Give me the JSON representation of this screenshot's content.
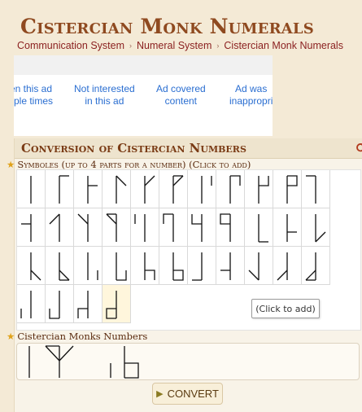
{
  "page": {
    "title": "Cistercian Monk Numerals",
    "breadcrumb": [
      "Communication System",
      "Numeral System",
      "Cistercian Monk Numerals"
    ]
  },
  "ad": {
    "options": [
      {
        "line1": "en this ad",
        "line2": "tiple times"
      },
      {
        "line1": "Not interested",
        "line2": "in this ad"
      },
      {
        "line1": "Ad covered",
        "line2": "content"
      },
      {
        "line1": "Ad was",
        "line2": "inappropri"
      }
    ]
  },
  "converter": {
    "section_title": "Conversion of Cistercian Numbers",
    "symbols_label": "Symboles (up to 4 parts for a number) (Click to add)",
    "tooltip": "(Click to add)",
    "numbers_label": "Cistercian Monks Numbers",
    "convert_label": "CONVERT",
    "colors": {
      "accent": "#8f4a20",
      "link": "#2a6ed1",
      "hover": "#fff6dc",
      "star": "#e0a21a"
    },
    "icons": {
      "section": "refresh-icon",
      "label": "star-icon",
      "button": "play-icon"
    },
    "symbols": [
      {
        "glyph": "stem"
      },
      {
        "glyph": "upper-right-1"
      },
      {
        "glyph": "upper-right-2"
      },
      {
        "glyph": "upper-right-3"
      },
      {
        "glyph": "upper-right-4"
      },
      {
        "glyph": "upper-right-5"
      },
      {
        "glyph": "upper-right-6"
      },
      {
        "glyph": "upper-right-7"
      },
      {
        "glyph": "upper-right-8"
      },
      {
        "glyph": "upper-right-9"
      },
      {
        "glyph": "upper-left-1"
      },
      {
        "glyph": "upper-left-2"
      },
      {
        "glyph": "upper-left-3"
      },
      {
        "glyph": "upper-left-4"
      },
      {
        "glyph": "upper-left-5"
      },
      {
        "glyph": "upper-left-6"
      },
      {
        "glyph": "upper-left-7"
      },
      {
        "glyph": "upper-left-8"
      },
      {
        "glyph": "upper-left-9"
      },
      {
        "glyph": "lower-right-1"
      },
      {
        "glyph": "lower-right-2"
      },
      {
        "glyph": "lower-right-3"
      },
      {
        "glyph": "lower-right-4"
      },
      {
        "glyph": "lower-right-5"
      },
      {
        "glyph": "lower-right-6"
      },
      {
        "glyph": "lower-right-7"
      },
      {
        "glyph": "lower-right-8"
      },
      {
        "glyph": "lower-right-9"
      },
      {
        "glyph": "lower-left-1"
      },
      {
        "glyph": "lower-left-2"
      },
      {
        "glyph": "lower-left-3"
      },
      {
        "glyph": "lower-left-4"
      },
      {
        "glyph": "lower-left-5"
      },
      {
        "glyph": "lower-left-6"
      },
      {
        "glyph": "lower-left-7"
      },
      {
        "glyph": "lower-left-8"
      },
      {
        "glyph": "lower-left-9",
        "hovered": true
      }
    ],
    "entered_numerals": [
      {
        "glyphs": [
          "stem"
        ]
      },
      {
        "glyphs": [
          "stem",
          "upper-right-4",
          "upper-left-5"
        ]
      },
      {
        "glyphs": [
          "stem",
          "lower-right-9",
          "lower-left-6"
        ]
      }
    ]
  }
}
